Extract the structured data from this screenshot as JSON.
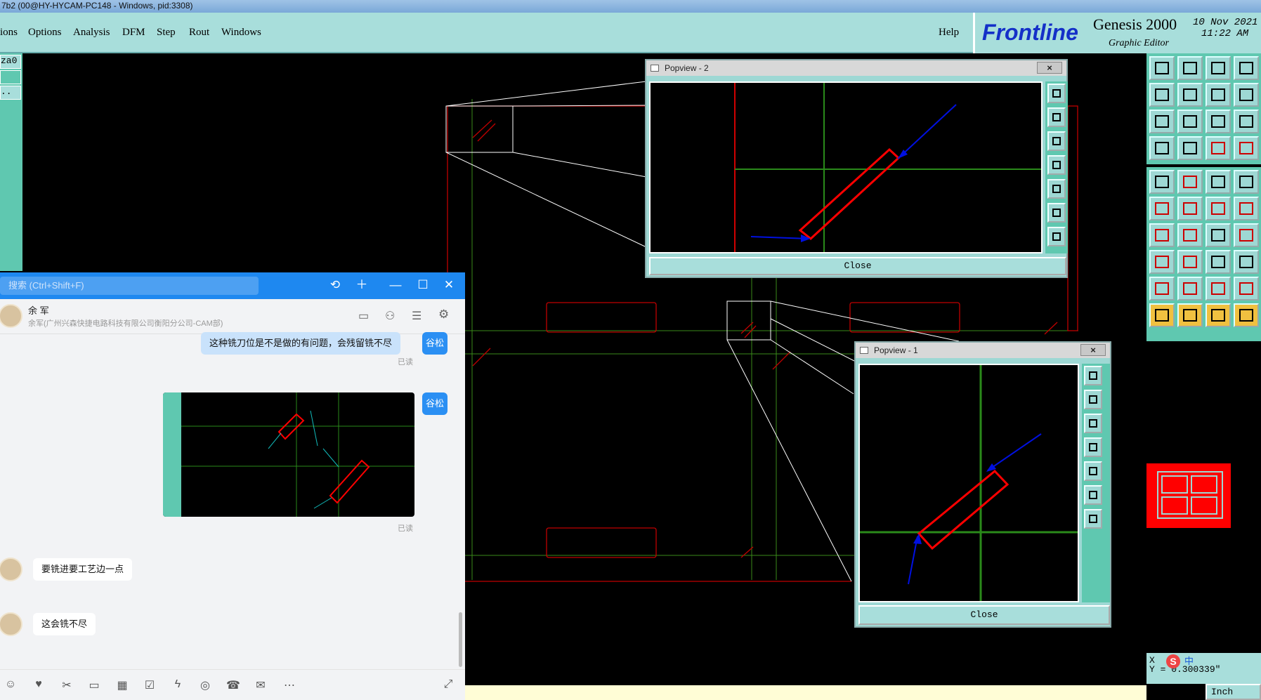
{
  "titlebar": {
    "text": "7b2 (00@HY-HYCAM-PC148 - Windows, pid:3308)"
  },
  "menu": {
    "items": [
      "ions",
      "Options",
      "Analysis",
      "DFM",
      "Step",
      "Rout",
      "Windows"
    ],
    "help": "Help"
  },
  "brand": {
    "logo": "Frontline",
    "product": "Genesis 2000",
    "subtitle": "Graphic Editor",
    "date": "10 Nov 2021",
    "time": "11:22 AM"
  },
  "left_strip": {
    "field1": "za0",
    "field2": ".."
  },
  "popview2": {
    "title": "Popview - 2",
    "close_x": "×",
    "close_button": "Close"
  },
  "popview1": {
    "title": "Popview - 1",
    "close_x": "×",
    "close_button": "Close"
  },
  "chat": {
    "search_placeholder": "搜索 (Ctrl+Shift+F)",
    "contact_name": "余 军",
    "contact_org": "余军(广州兴森快捷电路科技有限公司衡阳分公司-CAM部)",
    "messages": [
      {
        "from": "me",
        "text": "这种铣刀位是不是做的有问题，会残留铣不尽",
        "tag": "谷松",
        "status": "已读"
      },
      {
        "from": "me",
        "type": "image",
        "tag": "谷松",
        "status": "已读"
      },
      {
        "from": "other",
        "text": "要铣进要工艺边一点"
      },
      {
        "from": "other",
        "text": "这会铣不尽"
      }
    ]
  },
  "coords": {
    "x_label": "X",
    "y_text": "Y = 0.300339\""
  },
  "units": {
    "label": "Inch"
  },
  "ime": {
    "label": "中"
  },
  "colors": {
    "board_outline": "#c00000",
    "grid": "#3a8a1a",
    "highlight": "#ff0000",
    "arrow": "#0010e0",
    "panel_bg": "#a8dedb",
    "chat_accent": "#1e88f0"
  }
}
